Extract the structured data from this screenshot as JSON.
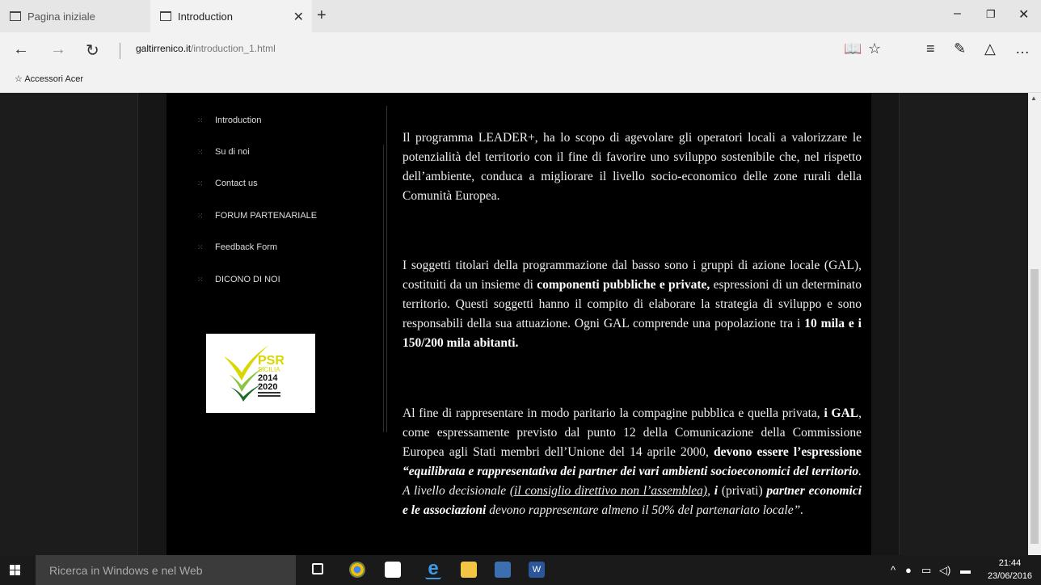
{
  "browser": {
    "tabs": [
      {
        "label": "Pagina iniziale",
        "active": false
      },
      {
        "label": "Introduction",
        "active": true
      }
    ],
    "url_host": "galtirrenico.it",
    "url_path": "/introduction_1.html",
    "favorites_bar": {
      "item": "Accessori Acer"
    }
  },
  "page": {
    "menu": [
      {
        "label": "Introduction"
      },
      {
        "label": "Su di noi"
      },
      {
        "label": "Contact us"
      },
      {
        "label": "FORUM PARTENARIALE"
      },
      {
        "label": "Feedback Form"
      },
      {
        "label": "DICONO DI NOI"
      }
    ],
    "logo": {
      "line1": "PSR",
      "line2": "SICILIA",
      "line3": "2014",
      "line4": "2020",
      "colors": {
        "green": "#8bc53f",
        "yellow": "#d8d800",
        "dark_green": "#1f6b2a"
      }
    },
    "paragraph1": "Il programma LEADER+, ha lo scopo di agevolare gli operatori locali a valorizzare le potenzialità del territorio con il fine di favorire uno sviluppo sostenibile che, nel rispetto dell’ambiente, conduca a migliorare il livello socio-economico delle zone rurali della Comunità Europea.",
    "paragraph2": {
      "part1": "I soggetti titolari della programmazione dal basso sono i gruppi di azione locale (GAL), costituiti da un insieme di ",
      "bold1": "componenti pubbliche e private,",
      "part2": " espressioni di un determinato territorio. Questi soggetti hanno il compito di elaborare la strategia di sviluppo e sono responsabili della sua attuazione. Ogni GAL comprende una popolazione  tra i ",
      "bold2": "10 mila e i 150/200 mila abitanti."
    },
    "paragraph3": {
      "part1": "Al fine di rappresentare in modo paritario la compagine pubblica e quella privata, ",
      "bold1": "i GAL",
      "part2": ", come espressamente previsto dal punto 12 della Comunicazione della Commissione Europea agli Stati membri dell’Unione del 14 aprile 2000, ",
      "bold2": "devono essere l’espressione ",
      "bolditalic1": "“equilibrata e rappresentativa dei partner dei vari ambienti socioeconomici del territorio",
      "italic1": ". A livello decisionale ",
      "underline1": "(il consiglio direttivo non l’assemblea)",
      "italic2": ", ",
      "bolditalic2": "i",
      "part3": " (privati) ",
      "bolditalic3": "partner economici e le associazioni",
      "italic3": " devono rappresentare almeno il 50% del partenariato locale”."
    }
  },
  "taskbar": {
    "search_placeholder": "Ricerca in Windows e nel Web",
    "time": "21:44",
    "date": "23/06/2016"
  }
}
